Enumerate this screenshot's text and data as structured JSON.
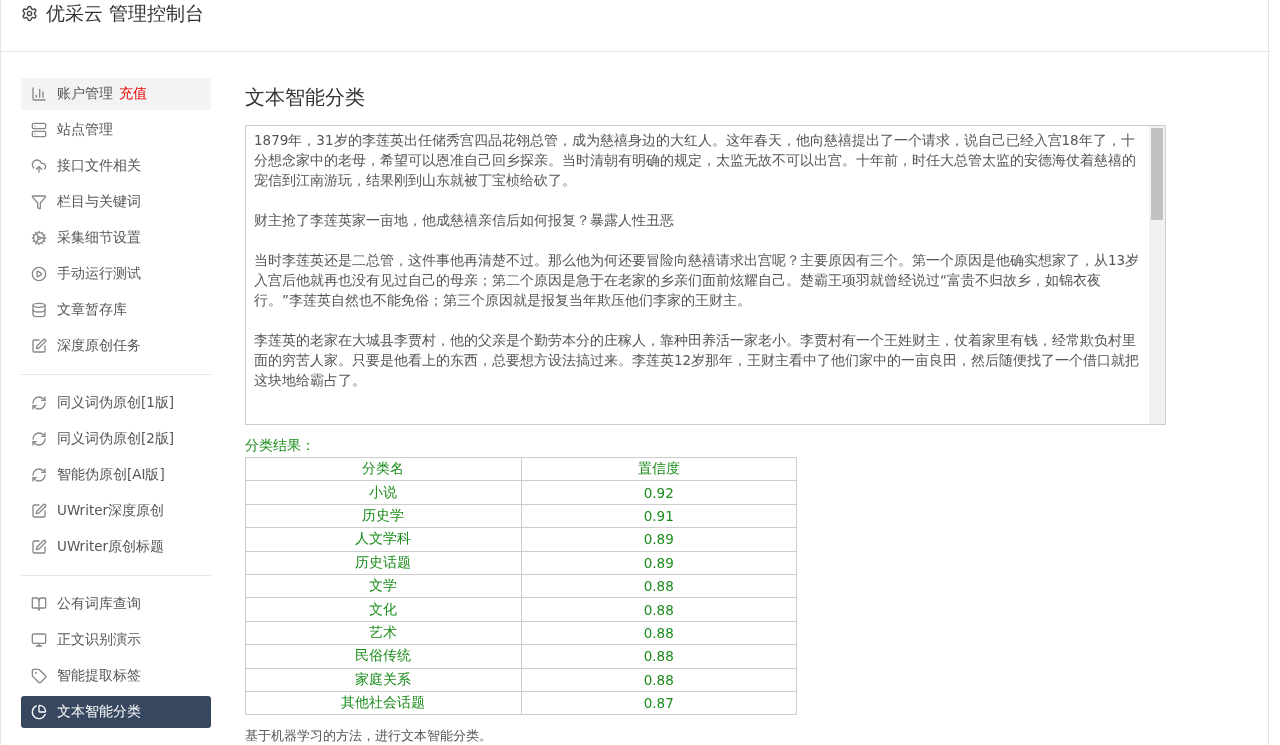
{
  "header": {
    "title": "优采云 管理控制台"
  },
  "sidebar": {
    "groups": [
      {
        "items": [
          {
            "label": "账户管理",
            "badge": "充值",
            "selected": false,
            "hovered": true
          },
          {
            "label": "站点管理",
            "selected": false,
            "hovered": false
          },
          {
            "label": "接口文件相关",
            "selected": false,
            "hovered": false
          },
          {
            "label": "栏目与关键词",
            "selected": false,
            "hovered": false
          },
          {
            "label": "采集细节设置",
            "selected": false,
            "hovered": false
          },
          {
            "label": "手动运行测试",
            "selected": false,
            "hovered": false
          },
          {
            "label": "文章暂存库",
            "selected": false,
            "hovered": false
          },
          {
            "label": "深度原创任务",
            "selected": false,
            "hovered": false
          }
        ]
      },
      {
        "items": [
          {
            "label": "同义词伪原创[1版]",
            "selected": false,
            "hovered": false
          },
          {
            "label": "同义词伪原创[2版]",
            "selected": false,
            "hovered": false
          },
          {
            "label": "智能伪原创[AI版]",
            "selected": false,
            "hovered": false
          },
          {
            "label": "UWriter深度原创",
            "selected": false,
            "hovered": false
          },
          {
            "label": "UWriter原创标题",
            "selected": false,
            "hovered": false
          }
        ]
      },
      {
        "items": [
          {
            "label": "公有词库查询",
            "selected": false,
            "hovered": false
          },
          {
            "label": "正文识别演示",
            "selected": false,
            "hovered": false
          },
          {
            "label": "智能提取标签",
            "selected": false,
            "hovered": false
          },
          {
            "label": "文本智能分类",
            "selected": true,
            "hovered": false
          }
        ]
      }
    ]
  },
  "main": {
    "title": "文本智能分类",
    "text_area": {
      "paragraphs": [
        "1879年，31岁的李莲英出任储秀宫四品花翎总管，成为慈禧身边的大红人。这年春天，他向慈禧提出了一个请求，说自己已经入宫18年了，十分想念家中的老母，希望可以恩准自己回乡探亲。当时清朝有明确的规定，太监无故不可以出宫。十年前，时任大总管太监的安德海仗着慈禧的宠信到江南游玩，结果刚到山东就被丁宝桢给砍了。",
        "财主抢了李莲英家一亩地，他成慈禧亲信后如何报复？暴露人性丑恶",
        "当时李莲英还是二总管，这件事他再清楚不过。那么他为何还要冒险向慈禧请求出宫呢？主要原因有三个。第一个原因是他确实想家了，从13岁入宫后他就再也没有见过自己的母亲；第二个原因是急于在老家的乡亲们面前炫耀自己。楚霸王项羽就曾经说过“富贵不归故乡，如锦衣夜行。”李莲英自然也不能免俗；第三个原因就是报复当年欺压他们李家的王财主。",
        "李莲英的老家在大城县李贾村，他的父亲是个勤劳本分的庄稼人，靠种田养活一家老小。李贾村有一个王姓财主，仗着家里有钱，经常欺负村里面的穷苦人家。只要是他看上的东西，总要想方设法搞过来。李莲英12岁那年，王财主看中了他们家中的一亩良田，然后随便找了一个借口就把这块地给霸占了。"
      ]
    },
    "result_label": "分类结果：",
    "table": {
      "columns": [
        "分类名",
        "置信度"
      ],
      "rows": [
        [
          "小说",
          "0.92"
        ],
        [
          "历史学",
          "0.91"
        ],
        [
          "人文学科",
          "0.89"
        ],
        [
          "历史话题",
          "0.89"
        ],
        [
          "文学",
          "0.88"
        ],
        [
          "文化",
          "0.88"
        ],
        [
          "艺术",
          "0.88"
        ],
        [
          "民俗传统",
          "0.88"
        ],
        [
          "家庭关系",
          "0.88"
        ],
        [
          "其他社会话题",
          "0.87"
        ]
      ]
    },
    "note": "基于机器学习的方法，进行文本智能分类。"
  }
}
